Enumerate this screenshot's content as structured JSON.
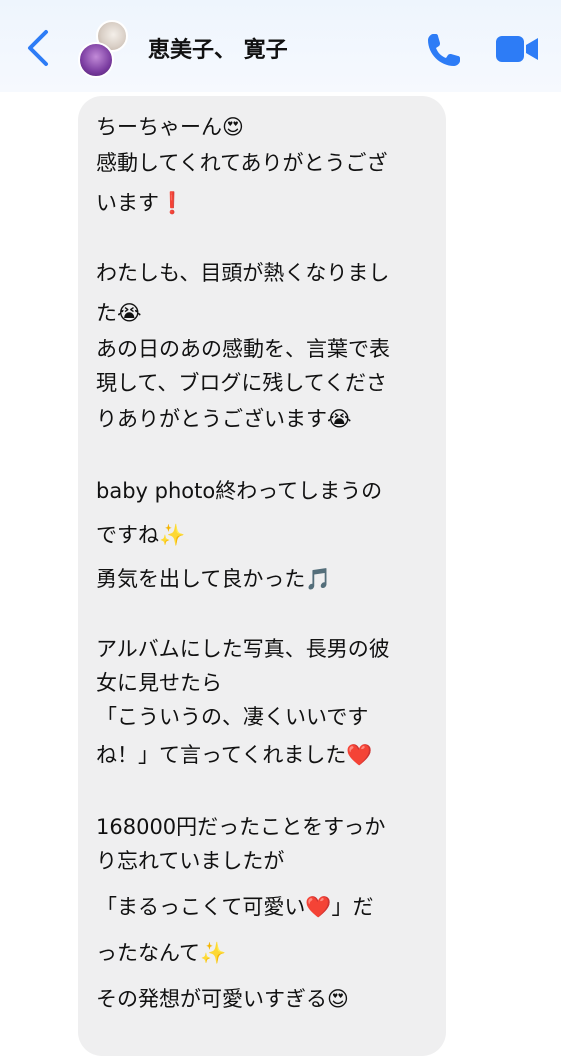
{
  "header": {
    "title": "恵美子、 寛子",
    "back_icon": "chevron-left-icon",
    "call_icon": "phone-icon",
    "video_icon": "video-camera-icon",
    "accent_color": "#2d7cf6"
  },
  "message": {
    "lines": [
      {
        "text": "ちーちゃーん😍"
      },
      {
        "text": "感動してくれてありがとうござ"
      },
      {
        "text": "います❗️"
      },
      {
        "text": "わたしも、目頭が熱くなりまし"
      },
      {
        "text": "た😭"
      },
      {
        "text": "あの日のあの感動を、言葉で表"
      },
      {
        "text": "現して、ブログに残してくださ"
      },
      {
        "text": "りありがとうございます😭"
      },
      {
        "text": "baby photo終わってしまうの"
      },
      {
        "text": "ですね✨"
      },
      {
        "text": "勇気を出して良かった🎵"
      },
      {
        "text": "アルバムにした写真、長男の彼"
      },
      {
        "text": "女に見せたら"
      },
      {
        "text": "「こういうの、凄くいいです"
      },
      {
        "text": "ね！」て言ってくれました❤️"
      },
      {
        "text": "168000円だったことをすっか"
      },
      {
        "text": "り忘れていましたが"
      },
      {
        "text": "「まるっこくて可愛い❤️」だ"
      },
      {
        "text": "ったなんて✨"
      },
      {
        "text": "その発想が可愛いすぎる😍"
      }
    ]
  }
}
